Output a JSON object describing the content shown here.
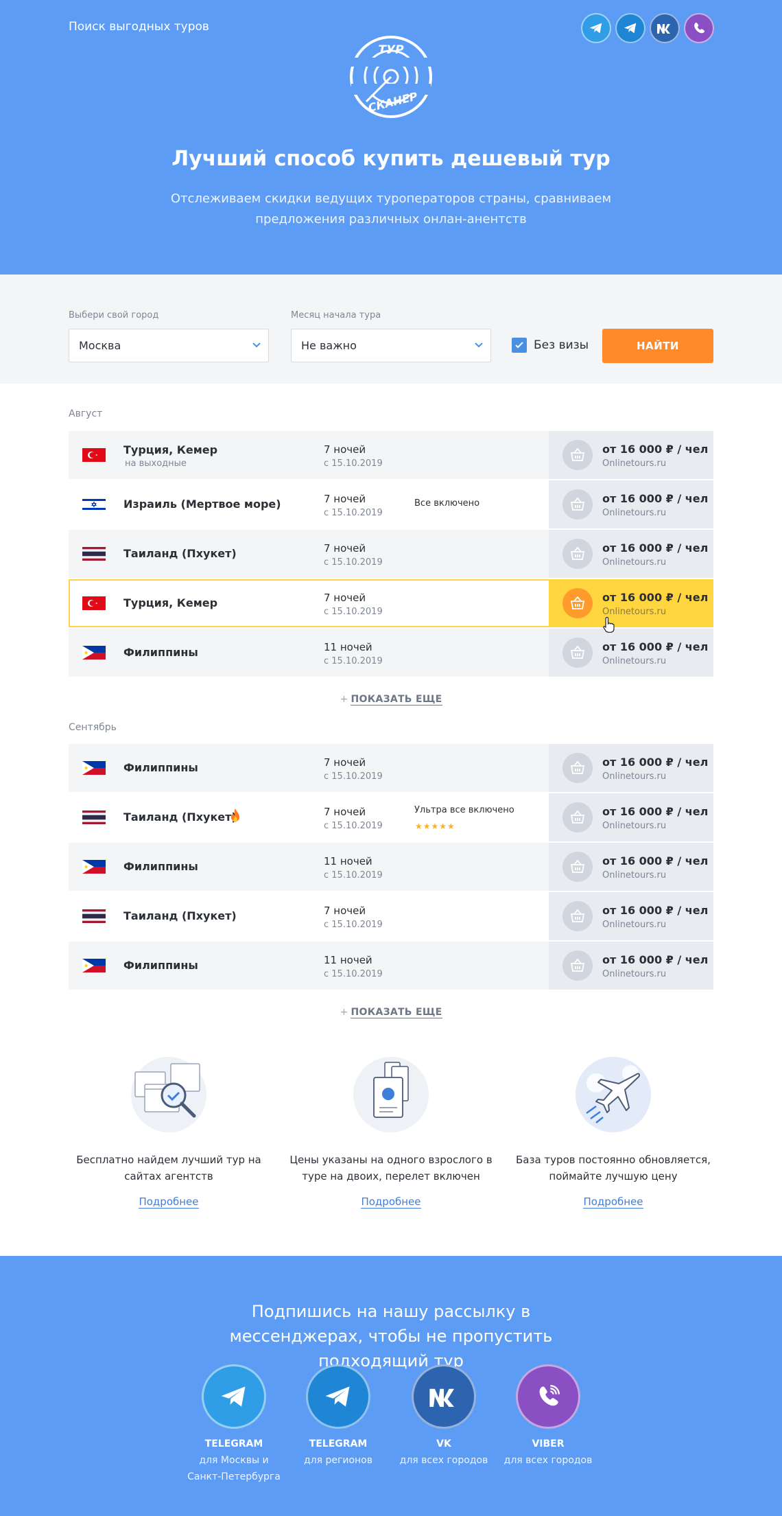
{
  "header": {
    "brand_text": "Поиск выгодных туров",
    "logo_top": "ТУР",
    "logo_bottom": "СКАНЕР",
    "title": "Лучший способ купить дешевый тур",
    "subtitle": "Отслеживаем скидки ведущих туроператоров страны, сравниваем предложения различных онлан-анентств",
    "socials": [
      "telegram-icon",
      "telegram-icon",
      "vk-icon",
      "viber-icon"
    ]
  },
  "search": {
    "city_label": "Выбери свой город",
    "city_value": "Москва",
    "month_label": "Месяц начала тура",
    "month_value": "Не важно",
    "visa_label": "Без визы",
    "visa_checked": true,
    "find_label": "НАЙТИ"
  },
  "sections": [
    {
      "month": "Август",
      "rows": [
        {
          "country": "Турция, Кемер",
          "note": "на выходные",
          "nights": "7 ночей",
          "date": "с 15.10.2019",
          "meal": "",
          "price": "от 16 000 ₽ / чел",
          "agency": "Onlinetours.ru"
        },
        {
          "country": "Израиль (Мертвое море)",
          "note": "",
          "nights": "7 ночей",
          "date": "с 15.10.2019",
          "meal": "Все включено",
          "price": "от 16 000 ₽ / чел",
          "agency": "Onlinetours.ru"
        },
        {
          "country": "Таиланд (Пхукет)",
          "note": "",
          "nights": "7 ночей",
          "date": "с 15.10.2019",
          "meal": "",
          "price": "от 16 000 ₽ / чел",
          "agency": "Onlinetours.ru"
        },
        {
          "country": "Турция, Кемер",
          "note": "",
          "nights": "7 ночей",
          "date": "с 15.10.2019",
          "meal": "",
          "price": "от 16 000 ₽ / чел",
          "agency": "Onlinetours.ru"
        },
        {
          "country": "Филиппины",
          "note": "",
          "nights": "11 ночей",
          "date": "с 15.10.2019",
          "meal": "",
          "price": "от 16 000 ₽ / чел",
          "agency": "Onlinetours.ru"
        }
      ],
      "more": "ПОКАЗАТЬ ЕЩЕ"
    },
    {
      "month": "Сентябрь",
      "rows": [
        {
          "country": "Филиппины",
          "note": "",
          "nights": "7 ночей",
          "date": "с 15.10.2019",
          "meal": "",
          "price": "от 16 000 ₽ / чел",
          "agency": "Onlinetours.ru"
        },
        {
          "country": "Таиланд (Пхукет)",
          "note": "",
          "nights": "7 ночей",
          "date": "с 15.10.2019",
          "meal": "Ультра все включено",
          "stars": "★★★★★",
          "price": "от 16 000 ₽ / чел",
          "agency": "Onlinetours.ru"
        },
        {
          "country": "Филиппины",
          "note": "",
          "nights": "11 ночей",
          "date": "с 15.10.2019",
          "meal": "",
          "price": "от 16 000 ₽ / чел",
          "agency": "Onlinetours.ru"
        },
        {
          "country": "Таиланд (Пхукет)",
          "note": "",
          "nights": "7 ночей",
          "date": "с 15.10.2019",
          "meal": "",
          "price": "от 16 000 ₽ / чел",
          "agency": "Onlinetours.ru"
        },
        {
          "country": "Филиппины",
          "note": "",
          "nights": "11 ночей",
          "date": "с 15.10.2019",
          "meal": "",
          "price": "от 16 000 ₽ / чел",
          "agency": "Onlinetours.ru"
        }
      ],
      "more": "ПОКАЗАТЬ ЕЩЕ"
    }
  ],
  "features": [
    {
      "text": "Бесплатно найдем лучший тур на сайтах агентств",
      "link": "Подробнее",
      "icon": "browser-search-icon"
    },
    {
      "text": "Цены указаны на одного взрослого в туре на двоих, перелет включен",
      "link": "Подробнее",
      "icon": "passport-tickets-icon"
    },
    {
      "text": "База туров постоянно обновляется, поймайте лучшую цену",
      "link": "Подробнее",
      "icon": "airplane-icon"
    }
  ],
  "footer": {
    "title": "Подпишись на нашу рассылку в мессенджерах, чтобы не пропустить подходящий тур",
    "messengers": [
      {
        "name": "TELEGRAM",
        "desc1": "для Москвы и",
        "desc2": "Санкт-Петербурга",
        "icon": "telegram-icon"
      },
      {
        "name": "TELEGRAM",
        "desc1": "для регионов",
        "desc2": "",
        "icon": "telegram-icon"
      },
      {
        "name": "VK",
        "desc1": "для всех городов",
        "desc2": "",
        "icon": "vk-icon"
      },
      {
        "name": "VIBER",
        "desc1": "для всех городов",
        "desc2": "",
        "icon": "viber-icon"
      }
    ]
  },
  "colors": {
    "primary_blue": "#5d9cf5",
    "orange": "#ff8a2a",
    "highlight_yellow": "#ffd640",
    "row_grey": "#f4f5f7"
  }
}
